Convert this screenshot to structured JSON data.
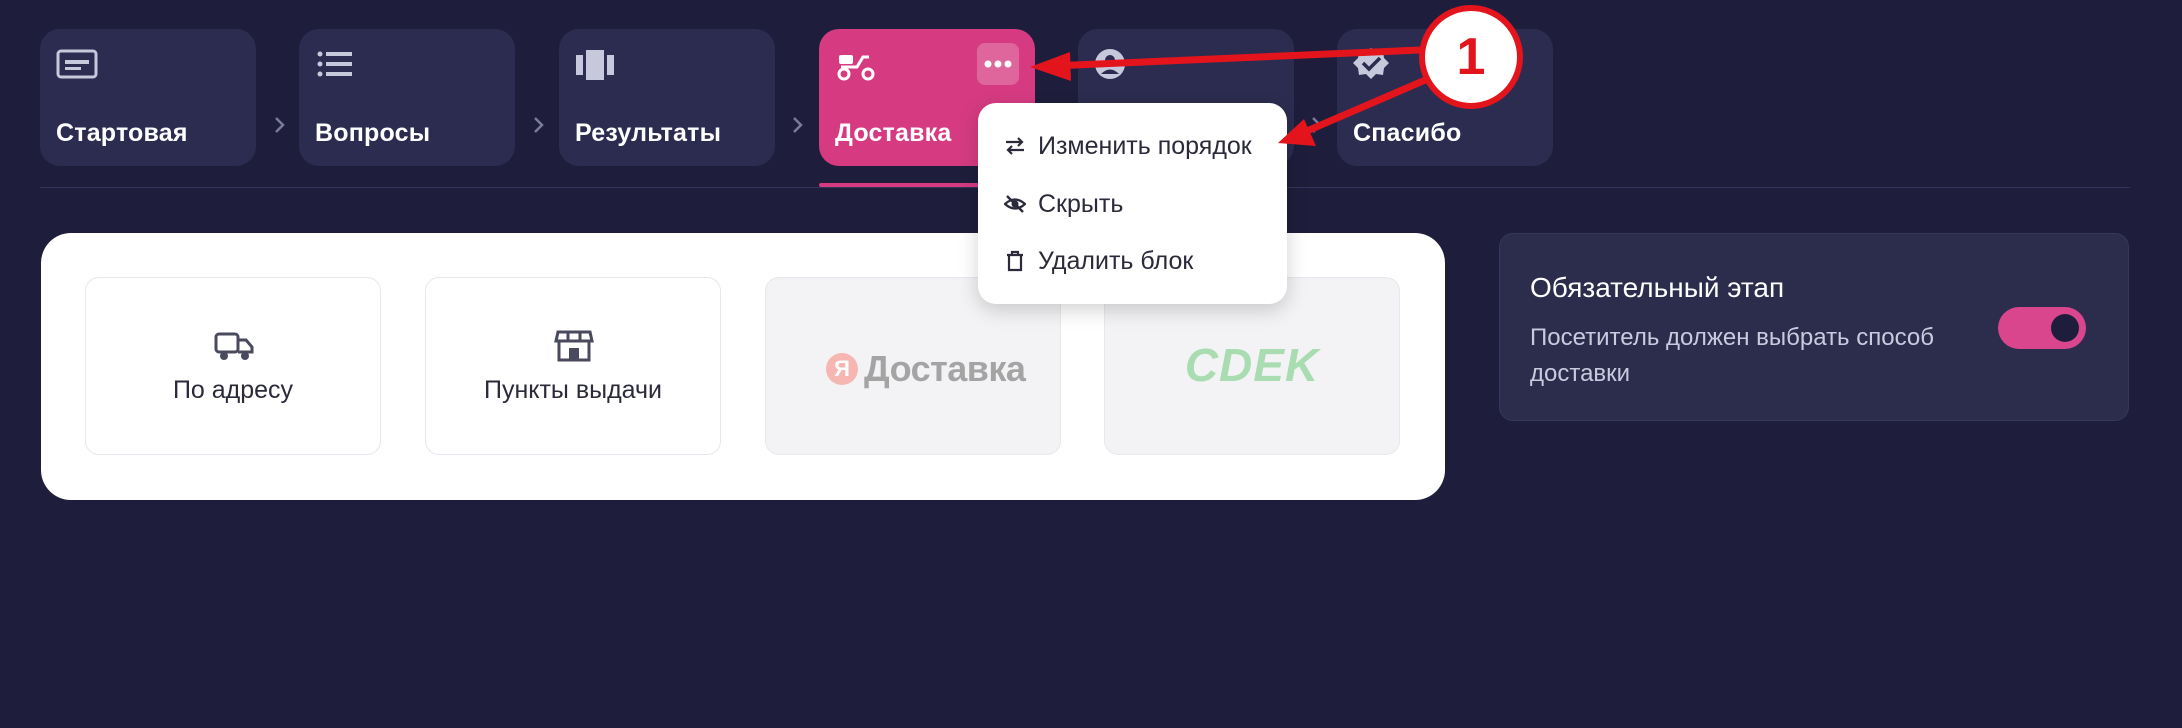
{
  "steps": [
    {
      "label": "Стартовая",
      "icon": "window-icon"
    },
    {
      "label": "Вопросы",
      "icon": "list-icon"
    },
    {
      "label": "Результаты",
      "icon": "carousel-icon"
    },
    {
      "label": "Доставка",
      "icon": "scooter-icon",
      "active": true
    },
    {
      "label": "",
      "icon": "user-icon"
    },
    {
      "label": "Спасибо",
      "icon": "verified-badge-icon"
    }
  ],
  "dropdown": {
    "items": [
      {
        "label": "Изменить порядок",
        "icon": "swap-arrows-icon"
      },
      {
        "label": "Скрыть",
        "icon": "eye-off-icon"
      },
      {
        "label": "Удалить блок",
        "icon": "trash-icon"
      }
    ]
  },
  "delivery_methods": [
    {
      "label": "По адресу",
      "icon": "truck-icon"
    },
    {
      "label": "Пункты выдачи",
      "icon": "store-icon"
    },
    {
      "logo_letter": "Я",
      "logo_text": "Доставка",
      "disabled": true
    },
    {
      "logo_text": "CDEK",
      "disabled": true
    }
  ],
  "panel": {
    "title": "Обязательный этап",
    "description": "Посетитель должен выбрать способ доставки",
    "toggle_on": true
  },
  "annotation": {
    "number": "1"
  },
  "colors": {
    "background": "#1e1e3c",
    "step": "#2c2c50",
    "accent": "#d63b82",
    "annotation": "#e4141c"
  }
}
